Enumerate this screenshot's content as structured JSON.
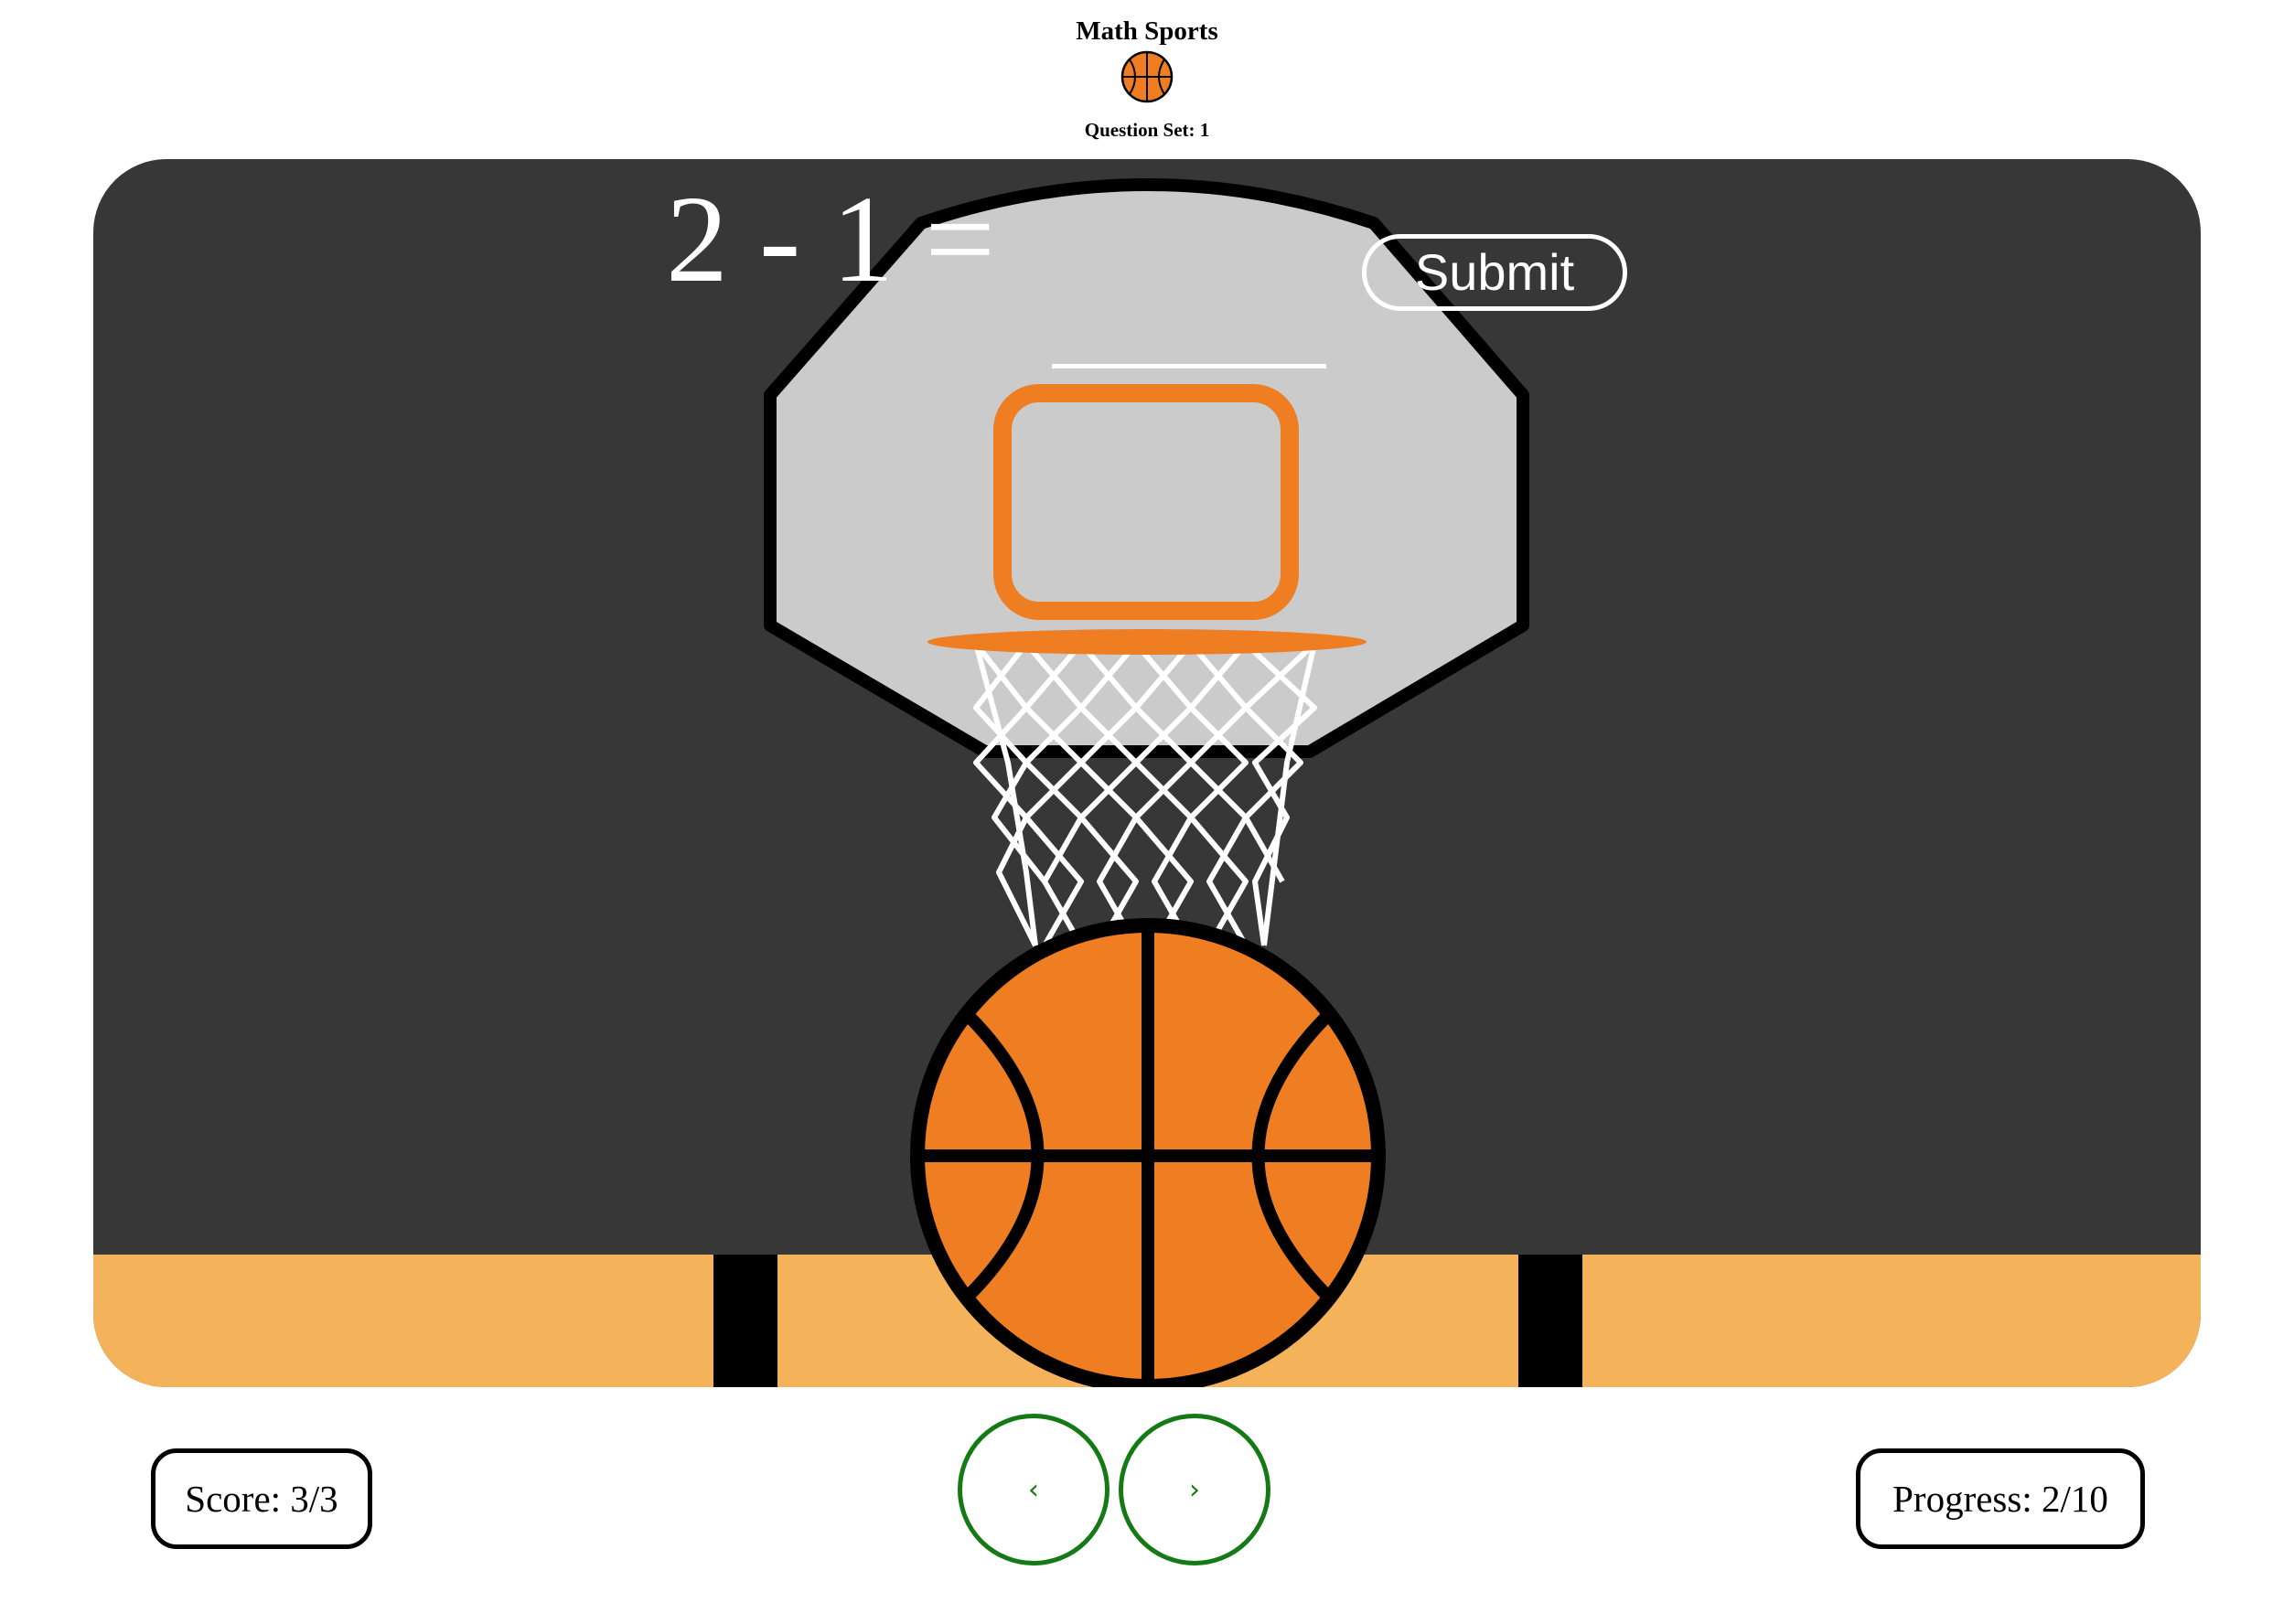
{
  "header": {
    "title": "Math Sports",
    "question_set_label": "Question Set: 1",
    "icon": "basketball-icon"
  },
  "question": {
    "equation": "2 - 1 =",
    "answer_value": "",
    "submit_label": "Submit"
  },
  "footer": {
    "score_label": "Score: 3/3",
    "progress_label": "Progress: 2/10",
    "prev_label": "‹",
    "next_label": "›"
  },
  "colors": {
    "court_background": "#373737",
    "floor": "#f4b35a",
    "ball_orange": "#ef7d22",
    "backboard": "#cbcbcb",
    "nav_green": "#157a15"
  }
}
